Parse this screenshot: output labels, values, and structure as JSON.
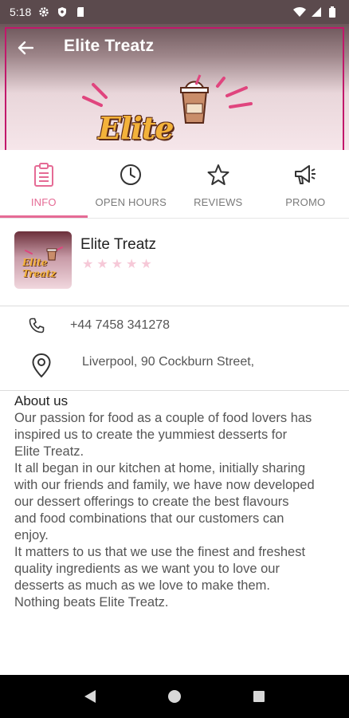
{
  "status_bar": {
    "time": "5:18"
  },
  "header": {
    "title": "Elite Treatz",
    "logo_text": "Elite Treatz",
    "accent": "#c2186b"
  },
  "tabs": [
    {
      "label": "INFO",
      "icon": "clipboard-icon",
      "active": true
    },
    {
      "label": "OPEN HOURS",
      "icon": "clock-icon",
      "active": false
    },
    {
      "label": "REVIEWS",
      "icon": "star-outline-icon",
      "active": false
    },
    {
      "label": "PROMO",
      "icon": "megaphone-icon",
      "active": false
    }
  ],
  "shop": {
    "name": "Elite Treatz",
    "avatar_text": "Elite Treatz",
    "rating": 0,
    "max_rating": 5
  },
  "contact": {
    "phone": "+44 7458 341278",
    "address": "Liverpool, 90 Cockburn Street,"
  },
  "about": {
    "title": "About us",
    "body": "Our passion for food as a couple of food lovers has\ninspired us to create the yummiest desserts for\nElite Treatz.\nIt all began in our kitchen at home, initially sharing\nwith our friends and family, we have now developed\nour dessert offerings to create the best flavours\nand food combinations that our customers can\nenjoy.\nIt matters to us that we use the finest and freshest\nquality ingredients as we want you to love our\ndesserts as much as we love to make them.\nNothing beats Elite Treatz."
  },
  "colors": {
    "active_tab": "#e56b95",
    "star_empty": "#f6c9d8",
    "status_bar": "#5b4a4d"
  }
}
